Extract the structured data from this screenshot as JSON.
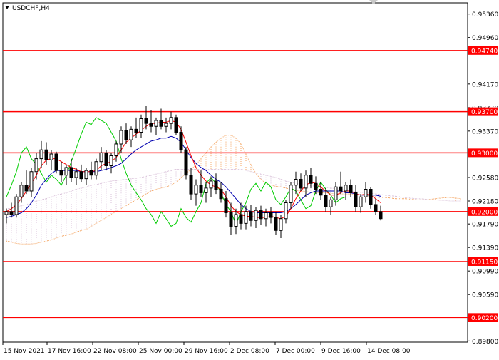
{
  "header": {
    "symbol_timeframe": "USDCHF,H4",
    "menu_icon": "triangle-down-icon",
    "scroll_icon": "shift-marker-icon"
  },
  "colors": {
    "background": "#ffffff",
    "grid": "#000000",
    "bull_candle": "#ffffff",
    "bear_candle": "#000000",
    "tenkan_sen": "#ff0000",
    "kijun_sen": "#0000b0",
    "chikou_span": "#00cc00",
    "senkou_a": "#f4a460",
    "senkou_b": "#d8bfd8",
    "level_line": "#ff0000",
    "level_label_bg": "#ff0000",
    "level_label_text": "#ffffff"
  },
  "chart_data": {
    "type": "line",
    "title": "USDCHF,H4",
    "x_ticks": [
      "15 Nov 2021",
      "17 Nov 16:00",
      "22 Nov 08:00",
      "25 Nov 00:00",
      "29 Nov 16:00",
      "2 Dec 08:00",
      "7 Dec 00:00",
      "9 Dec 16:00",
      "14 Dec 08:00"
    ],
    "y_ticks": [
      "0.95360",
      "0.94960",
      "0.94740",
      "0.94170",
      "0.93770",
      "0.93700",
      "0.93370",
      "0.93000",
      "0.92580",
      "0.92180",
      "0.92000",
      "0.91790",
      "0.91390",
      "0.91150",
      "0.90990",
      "0.90590",
      "0.90200",
      "0.89800"
    ],
    "ylim": [
      0.8978,
      0.9555
    ],
    "horizontal_levels": [
      0.9474,
      0.937,
      0.93,
      0.92,
      0.9115,
      0.902
    ],
    "level_labels": [
      "0.94740",
      "0.93700",
      "0.93000",
      "0.92000",
      "0.91150",
      "0.90200"
    ],
    "grid": false,
    "candles": [
      [
        0.9195,
        0.9205,
        0.918,
        0.92
      ],
      [
        0.92,
        0.9215,
        0.919,
        0.9195
      ],
      [
        0.9195,
        0.923,
        0.919,
        0.9225
      ],
      [
        0.9225,
        0.925,
        0.9215,
        0.9245
      ],
      [
        0.9245,
        0.927,
        0.923,
        0.9235
      ],
      [
        0.9235,
        0.9275,
        0.9225,
        0.9268
      ],
      [
        0.9268,
        0.93,
        0.9255,
        0.929
      ],
      [
        0.929,
        0.932,
        0.9275,
        0.9305
      ],
      [
        0.9305,
        0.9318,
        0.928,
        0.9288
      ],
      [
        0.9288,
        0.9305,
        0.927,
        0.9298
      ],
      [
        0.9298,
        0.9302,
        0.9265,
        0.927
      ],
      [
        0.927,
        0.9285,
        0.925,
        0.9262
      ],
      [
        0.9262,
        0.928,
        0.9245,
        0.9275
      ],
      [
        0.9275,
        0.929,
        0.925,
        0.9258
      ],
      [
        0.9258,
        0.9275,
        0.9245,
        0.9268
      ],
      [
        0.9268,
        0.928,
        0.925,
        0.9256
      ],
      [
        0.9256,
        0.9275,
        0.9245,
        0.927
      ],
      [
        0.927,
        0.9285,
        0.9255,
        0.9262
      ],
      [
        0.9262,
        0.929,
        0.9255,
        0.9285
      ],
      [
        0.9285,
        0.931,
        0.927,
        0.93
      ],
      [
        0.93,
        0.9305,
        0.927,
        0.9278
      ],
      [
        0.9278,
        0.93,
        0.9265,
        0.9295
      ],
      [
        0.9295,
        0.932,
        0.9285,
        0.9315
      ],
      [
        0.9315,
        0.9345,
        0.93,
        0.9338
      ],
      [
        0.9338,
        0.935,
        0.9315,
        0.9322
      ],
      [
        0.9322,
        0.9345,
        0.931,
        0.934
      ],
      [
        0.934,
        0.936,
        0.9325,
        0.9335
      ],
      [
        0.9335,
        0.9365,
        0.9325,
        0.9358
      ],
      [
        0.9358,
        0.938,
        0.934,
        0.935
      ],
      [
        0.935,
        0.9372,
        0.9335,
        0.9345
      ],
      [
        0.9345,
        0.936,
        0.933,
        0.9355
      ],
      [
        0.9355,
        0.9375,
        0.934,
        0.9345
      ],
      [
        0.9345,
        0.936,
        0.9335,
        0.935
      ],
      [
        0.935,
        0.937,
        0.934,
        0.936
      ],
      [
        0.936,
        0.9365,
        0.933,
        0.9335
      ],
      [
        0.9335,
        0.9345,
        0.93,
        0.9305
      ],
      [
        0.9305,
        0.931,
        0.9255,
        0.9262
      ],
      [
        0.9262,
        0.9275,
        0.922,
        0.923
      ],
      [
        0.923,
        0.9255,
        0.921,
        0.9245
      ],
      [
        0.9245,
        0.927,
        0.9225,
        0.9232
      ],
      [
        0.9232,
        0.925,
        0.9215,
        0.924
      ],
      [
        0.924,
        0.926,
        0.9225,
        0.9252
      ],
      [
        0.9252,
        0.9265,
        0.923,
        0.9238
      ],
      [
        0.9238,
        0.925,
        0.9215,
        0.9222
      ],
      [
        0.9222,
        0.9235,
        0.919,
        0.9198
      ],
      [
        0.9198,
        0.9215,
        0.916,
        0.9175
      ],
      [
        0.9175,
        0.9205,
        0.9162,
        0.9195
      ],
      [
        0.9195,
        0.9215,
        0.917,
        0.918
      ],
      [
        0.918,
        0.921,
        0.917,
        0.92
      ],
      [
        0.92,
        0.9212,
        0.9175,
        0.9185
      ],
      [
        0.9185,
        0.9208,
        0.9172,
        0.9202
      ],
      [
        0.9202,
        0.921,
        0.9178,
        0.9188
      ],
      [
        0.9188,
        0.9205,
        0.9175,
        0.9198
      ],
      [
        0.9198,
        0.9208,
        0.918,
        0.919
      ],
      [
        0.919,
        0.92,
        0.916,
        0.9168
      ],
      [
        0.9168,
        0.9195,
        0.9155,
        0.9188
      ],
      [
        0.9188,
        0.922,
        0.918,
        0.9215
      ],
      [
        0.9215,
        0.925,
        0.9205,
        0.9245
      ],
      [
        0.9245,
        0.9268,
        0.923,
        0.9255
      ],
      [
        0.9255,
        0.9265,
        0.9235,
        0.924
      ],
      [
        0.924,
        0.927,
        0.9225,
        0.9262
      ],
      [
        0.9262,
        0.9275,
        0.924,
        0.9248
      ],
      [
        0.9248,
        0.926,
        0.923,
        0.9238
      ],
      [
        0.9238,
        0.925,
        0.922,
        0.9228
      ],
      [
        0.9228,
        0.924,
        0.92,
        0.9208
      ],
      [
        0.9208,
        0.9225,
        0.9195,
        0.922
      ],
      [
        0.922,
        0.925,
        0.921,
        0.9242
      ],
      [
        0.9242,
        0.9268,
        0.923,
        0.9235
      ],
      [
        0.9235,
        0.925,
        0.922,
        0.9245
      ],
      [
        0.9245,
        0.9255,
        0.9225,
        0.9232
      ],
      [
        0.9232,
        0.9245,
        0.92,
        0.9208
      ],
      [
        0.9208,
        0.923,
        0.9198,
        0.9225
      ],
      [
        0.9225,
        0.925,
        0.9215,
        0.9238
      ],
      [
        0.9238,
        0.9242,
        0.9205,
        0.9212
      ],
      [
        0.9212,
        0.9222,
        0.9195,
        0.92
      ],
      [
        0.92,
        0.921,
        0.9185,
        0.9188
      ]
    ],
    "series": [
      {
        "values": [
          0.92,
          0.9205,
          0.9212,
          0.9222,
          0.9235,
          0.9248,
          0.9262,
          0.9278,
          0.9288,
          0.929,
          0.929,
          0.9285,
          0.928,
          0.9275,
          0.9272,
          0.9268,
          0.9268,
          0.9268,
          0.927,
          0.9278,
          0.9282,
          0.9285,
          0.9292,
          0.9305,
          0.9318,
          0.9325,
          0.9332,
          0.9338,
          0.9345,
          0.935,
          0.935,
          0.9352,
          0.9352,
          0.9355,
          0.9352,
          0.934,
          0.9318,
          0.9295,
          0.9275,
          0.9262,
          0.9252,
          0.9245,
          0.9242,
          0.9238,
          0.9225,
          0.921,
          0.92,
          0.9195,
          0.9192,
          0.9192,
          0.919,
          0.919,
          0.919,
          0.9192,
          0.919,
          0.9188,
          0.9192,
          0.9205,
          0.9222,
          0.9235,
          0.9245,
          0.925,
          0.9248,
          0.9242,
          0.9235,
          0.9228,
          0.9228,
          0.9232,
          0.9235,
          0.9235,
          0.923,
          0.9228,
          0.923,
          0.9228,
          0.9222,
          0.9215
        ]
      },
      {
        "values": [
          0.919,
          0.9192,
          0.9195,
          0.9198,
          0.9205,
          0.9215,
          0.9228,
          0.9245,
          0.9255,
          0.9265,
          0.927,
          0.927,
          0.927,
          0.927,
          0.927,
          0.9268,
          0.9268,
          0.9268,
          0.9268,
          0.927,
          0.9272,
          0.9275,
          0.9278,
          0.9282,
          0.929,
          0.9298,
          0.9305,
          0.931,
          0.9315,
          0.932,
          0.9322,
          0.9325,
          0.9325,
          0.9328,
          0.9325,
          0.9318,
          0.9305,
          0.9292,
          0.9282,
          0.9275,
          0.927,
          0.9262,
          0.9255,
          0.925,
          0.9242,
          0.9232,
          0.9222,
          0.9212,
          0.9205,
          0.92,
          0.9198,
          0.9198,
          0.9198,
          0.9198,
          0.9198,
          0.9198,
          0.92,
          0.9205,
          0.9212,
          0.922,
          0.9228,
          0.9232,
          0.9235,
          0.9235,
          0.9235,
          0.9235,
          0.9235,
          0.9235,
          0.9232,
          0.9232,
          0.923,
          0.9228,
          0.9228,
          0.9228,
          0.9228,
          0.9226
        ]
      },
      {
        "values": [
          0.9225,
          0.9245,
          0.9268,
          0.93,
          0.931,
          0.929,
          0.928,
          0.9265,
          0.925,
          0.9262,
          0.9255,
          0.9245,
          0.9262,
          0.9285,
          0.9308,
          0.9332,
          0.9352,
          0.9348,
          0.936,
          0.9355,
          0.935,
          0.9335,
          0.932,
          0.929,
          0.9265,
          0.9245,
          0.9232,
          0.922,
          0.9205,
          0.9195,
          0.918,
          0.92,
          0.9188,
          0.9175,
          0.918,
          0.9205,
          0.919,
          0.9182,
          0.92,
          0.9215,
          0.9248,
          0.9258,
          0.9248,
          0.9232,
          0.9212,
          0.92,
          0.9178,
          0.92,
          0.9215,
          0.9238,
          0.9248,
          0.9235,
          0.925,
          0.9242,
          0.922,
          0.9212,
          0.9225,
          0.924,
          0.9235,
          0.922,
          0.9205,
          0.921,
          0.9235,
          0.925,
          0.9238,
          0.9228,
          0.9215,
          0.9222,
          0.9225
        ]
      },
      {
        "values": [
          0.915,
          0.9148,
          0.9146,
          0.9145,
          0.9145,
          0.9145,
          0.9146,
          0.9148,
          0.915,
          0.9152,
          0.9155,
          0.9158,
          0.916,
          0.9162,
          0.9165,
          0.9168,
          0.917,
          0.9175,
          0.918,
          0.9185,
          0.919,
          0.9195,
          0.92,
          0.9205,
          0.921,
          0.9215,
          0.922,
          0.9225,
          0.923,
          0.9235,
          0.9238,
          0.924,
          0.9242,
          0.9245,
          0.925,
          0.9258,
          0.9265,
          0.9272,
          0.928,
          0.929,
          0.93,
          0.931,
          0.9318,
          0.9325,
          0.933,
          0.933,
          0.9325,
          0.9315,
          0.9298,
          0.928,
          0.9265,
          0.9255,
          0.9248,
          0.9245,
          0.9243,
          0.9242,
          0.924,
          0.9238,
          0.9236,
          0.9235,
          0.9234,
          0.9233,
          0.9232,
          0.9232,
          0.9232,
          0.9231,
          0.923,
          0.923,
          0.923,
          0.923,
          0.9229,
          0.9228,
          0.9227,
          0.9226,
          0.9225,
          0.9224,
          0.9224,
          0.9223,
          0.9222,
          0.9222,
          0.9222,
          0.9221,
          0.922,
          0.922,
          0.922,
          0.9221,
          0.9222,
          0.9223,
          0.9224,
          0.9224,
          0.9223,
          0.9222
        ]
      },
      {
        "values": [
          0.9205,
          0.9205,
          0.9208,
          0.921,
          0.9212,
          0.9215,
          0.9218,
          0.922,
          0.9222,
          0.9225,
          0.9228,
          0.923,
          0.9232,
          0.9235,
          0.9238,
          0.924,
          0.9242,
          0.9245,
          0.9246,
          0.9248,
          0.925,
          0.9252,
          0.9253,
          0.9254,
          0.9255,
          0.9256,
          0.9257,
          0.9258,
          0.926,
          0.9262,
          0.9264,
          0.9266,
          0.9268,
          0.927,
          0.9272,
          0.9272,
          0.9272,
          0.9272,
          0.9272,
          0.9272,
          0.9272,
          0.9272,
          0.9272,
          0.9272,
          0.9272,
          0.9272,
          0.9272,
          0.9272,
          0.927,
          0.9268,
          0.9266,
          0.9264,
          0.9262,
          0.926,
          0.9258,
          0.9255,
          0.9252,
          0.925,
          0.9248,
          0.9246,
          0.9245,
          0.9244,
          0.9243,
          0.9242,
          0.9241,
          0.924,
          0.9239,
          0.9238,
          0.9236,
          0.9235,
          0.9234,
          0.9233,
          0.9232,
          0.9231,
          0.923,
          0.9229,
          0.9228,
          0.9227,
          0.9226,
          0.9225,
          0.9224,
          0.9223,
          0.9222,
          0.9222,
          0.9221,
          0.922,
          0.922,
          0.9219,
          0.9219,
          0.9218,
          0.9218,
          0.9218
        ]
      }
    ]
  }
}
